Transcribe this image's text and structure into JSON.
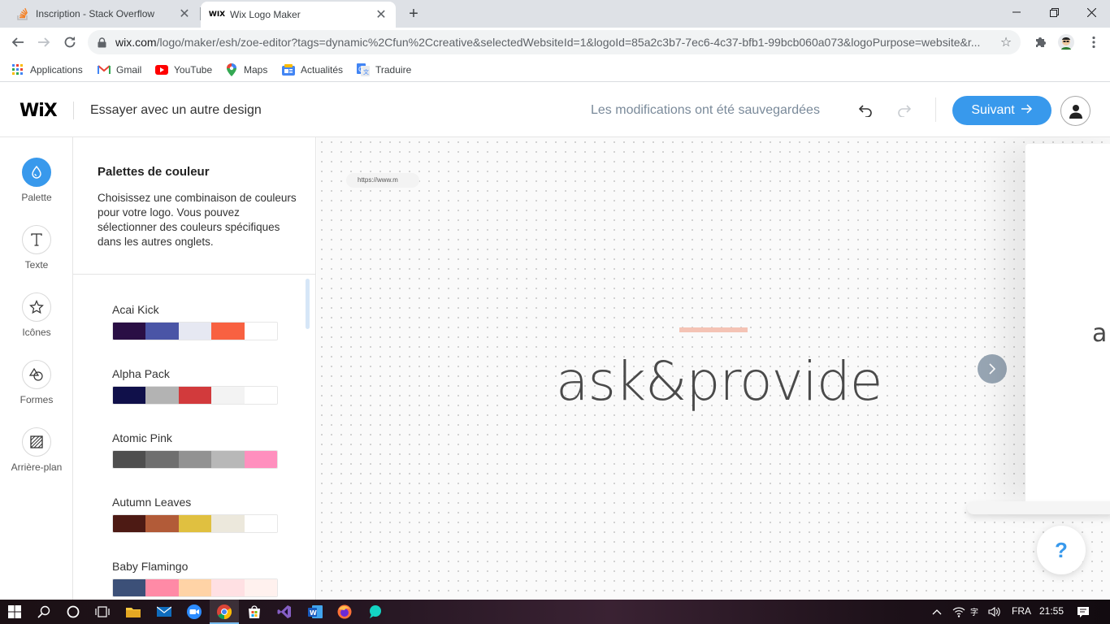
{
  "browser": {
    "tabs": [
      {
        "title": "Inscription - Stack Overflow",
        "active": false
      },
      {
        "title": "Wix Logo Maker",
        "active": true
      }
    ],
    "url_host": "wix.com",
    "url_rest": "/logo/maker/esh/zoe-editor?tags=dynamic%2Cfun%2Ccreative&selectedWebsiteId=1&logoId=85a2c3b7-7ec6-4c37-bfb1-99bcb060a073&logoPurpose=website&r...",
    "bookmarks": [
      {
        "label": "Applications",
        "icon": "apps-grid-icon"
      },
      {
        "label": "Gmail",
        "icon": "gmail-icon"
      },
      {
        "label": "YouTube",
        "icon": "youtube-icon"
      },
      {
        "label": "Maps",
        "icon": "maps-icon"
      },
      {
        "label": "Actualités",
        "icon": "news-icon"
      },
      {
        "label": "Traduire",
        "icon": "translate-icon"
      }
    ]
  },
  "header": {
    "logo": "WiX",
    "try_other": "Essayer avec un autre design",
    "saved_status": "Les modifications ont été sauvegardées",
    "next_label": "Suivant"
  },
  "rail": [
    {
      "label": "Palette",
      "icon": "droplet-icon",
      "active": true
    },
    {
      "label": "Texte",
      "icon": "text-t-icon",
      "active": false
    },
    {
      "label": "Icônes",
      "icon": "star-icon",
      "active": false
    },
    {
      "label": "Formes",
      "icon": "shapes-icon",
      "active": false
    },
    {
      "label": "Arrière-plan",
      "icon": "background-hatch-icon",
      "active": false
    }
  ],
  "panel": {
    "title": "Palettes de couleur",
    "description": "Choisissez une combinaison de couleurs pour votre logo. Vous pouvez sélectionner des couleurs spécifiques dans les autres onglets.",
    "palettes": [
      {
        "name": "Acai Kick",
        "colors": [
          "#2a0f45",
          "#4a55a6",
          "#e6e8f2",
          "#f86141",
          "#ffffff"
        ]
      },
      {
        "name": "Alpha Pack",
        "colors": [
          "#10104a",
          "#b3b3b3",
          "#d23a3c",
          "#f3f3f3",
          "#ffffff"
        ]
      },
      {
        "name": "Atomic Pink",
        "colors": [
          "#4e4e4e",
          "#6f6f6f",
          "#929292",
          "#b8b8b8",
          "#ff8fbe"
        ]
      },
      {
        "name": "Autumn Leaves",
        "colors": [
          "#4d1a14",
          "#b25b38",
          "#e0c040",
          "#ece8dc",
          "#ffffff"
        ]
      },
      {
        "name": "Baby Flamingo",
        "colors": [
          "#3c5078",
          "#ff8aa6",
          "#ffd3a6",
          "#ffe0e3",
          "#fff1ee"
        ]
      }
    ]
  },
  "canvas": {
    "logo_text": "ask&provide",
    "mockup_url": "https://www.m",
    "mockup_letter": "a",
    "help_label": "?"
  },
  "taskbar": {
    "language": "FRA",
    "time": "21:55"
  }
}
